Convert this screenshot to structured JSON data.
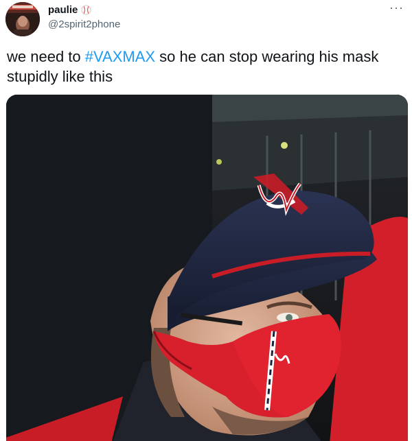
{
  "author": {
    "display_name": "paulie",
    "name_emoji": "baseball-icon",
    "handle": "@2spirit2phone"
  },
  "more_menu": {
    "label": "···",
    "icon": "more-horizontal-icon"
  },
  "tweet": {
    "text_before": "we need to ",
    "hashtag": "#VAXMAX",
    "text_after": " so he can stop wearing his mask stupidly like this"
  },
  "media": {
    "description_icon": "photo-baseball-player-mask"
  },
  "colors": {
    "link": "#1d9bf0",
    "text": "#0f1419",
    "secondary": "#536471"
  }
}
